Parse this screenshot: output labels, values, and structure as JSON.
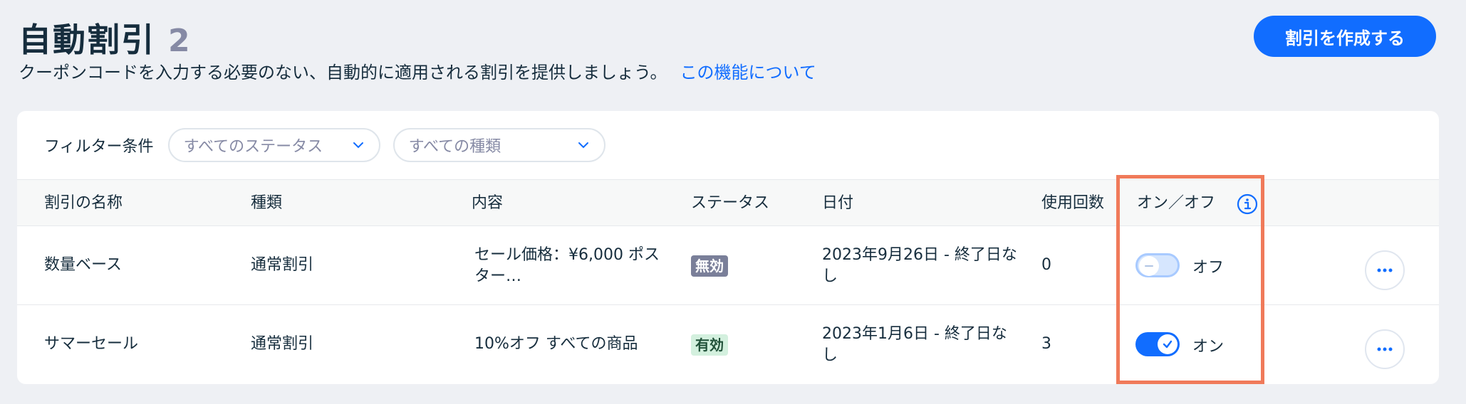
{
  "header": {
    "title": "自動割引",
    "count": "2",
    "subtitle": "クーポンコードを入力する必要のない、自動的に適用される割引を提供しましょう。",
    "learn_more": "この機能について",
    "create_button": "割引を作成する"
  },
  "filters": {
    "label": "フィルター条件",
    "status_value": "すべてのステータス",
    "type_value": "すべての種類"
  },
  "table": {
    "columns": {
      "name": "割引の名称",
      "type": "種類",
      "content": "内容",
      "status": "ステータス",
      "date": "日付",
      "uses": "使用回数",
      "onoff": "オン／オフ"
    },
    "rows": [
      {
        "name": "数量ベース",
        "type": "通常割引",
        "content": "セール価格：¥6,000 ポスター…",
        "status": "無効",
        "date": "2023年9月26日 - 終了日なし",
        "uses": "0",
        "toggle_on": false,
        "toggle_label": "オフ"
      },
      {
        "name": "サマーセール",
        "type": "通常割引",
        "content": "10%オフ すべての商品",
        "status": "有効",
        "date": "2023年1月6日 - 終了日なし",
        "uses": "3",
        "toggle_on": true,
        "toggle_label": "オン"
      }
    ]
  },
  "icons": {
    "filter_chevron": "chevron-down-icon",
    "column_info": "info-icon",
    "row_actions": "more-horizontal-icon",
    "toggle_check": "check-icon",
    "toggle_minus": "minus-icon"
  },
  "colors": {
    "accent": "#116dff",
    "background": "#eef0f4",
    "highlight": "#f07a5a",
    "badge_inactive": "#7a7f99",
    "badge_active_bg": "#d3f0de"
  }
}
